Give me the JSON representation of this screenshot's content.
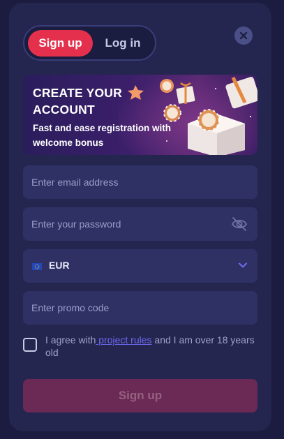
{
  "tabs": {
    "signup_label": "Sign up",
    "login_label": "Log in"
  },
  "banner": {
    "title": "CREATE YOUR ACCOUNT",
    "subtitle": "Fast and ease registration with welcome bonus"
  },
  "form": {
    "email_placeholder": "Enter email address",
    "password_placeholder": "Enter your password",
    "currency": "EUR",
    "promo_placeholder": "Enter promo code"
  },
  "agreement": {
    "prefix": "I agree with",
    "link": " project rules",
    "suffix": " and I am over 18 years old"
  },
  "submit_label": "Sign up",
  "colors": {
    "accent": "#e5304d",
    "background": "#24264f",
    "field": "#2f3165",
    "link": "#6e6af2"
  }
}
